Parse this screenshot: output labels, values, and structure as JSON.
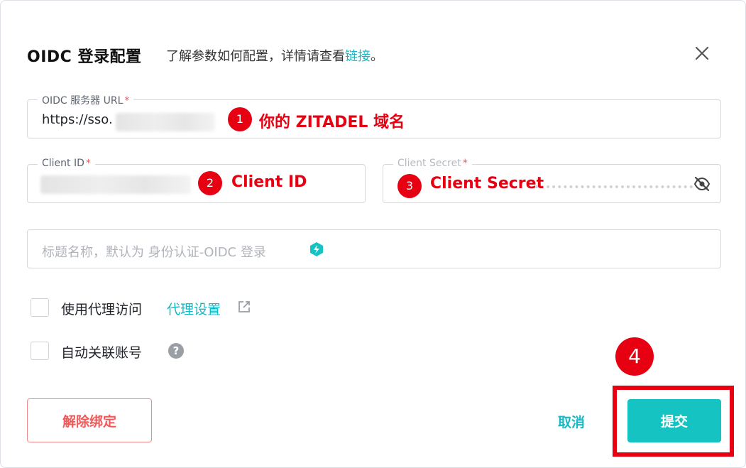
{
  "dialog": {
    "title": "OIDC 登录配置",
    "subtitle_prefix": "了解参数如何配置，详情请查看",
    "subtitle_link": "链接",
    "subtitle_suffix": "。",
    "close_icon": "close-icon"
  },
  "fields": {
    "server_url": {
      "label": "OIDC 服务器 URL",
      "required": "*",
      "value": "https://sso."
    },
    "client_id": {
      "label": "Client ID",
      "required": "*"
    },
    "client_secret": {
      "label": "Client Secret",
      "required": "*",
      "icon": "eye-off-icon"
    },
    "title": {
      "placeholder": "标题名称，默认为 身份认证-OIDC 登录",
      "icon": "brand-icon"
    }
  },
  "annotations": {
    "one": {
      "num": "1",
      "text": "你的 ZITADEL 域名"
    },
    "two": {
      "num": "2",
      "text": "Client ID"
    },
    "three": {
      "num": "3",
      "text": "Client Secret"
    },
    "four": {
      "num": "4"
    }
  },
  "options": {
    "use_proxy": {
      "label": "使用代理访问",
      "link": "代理设置",
      "checked": false
    },
    "auto_link": {
      "label": "自动关联账号",
      "help": "?",
      "checked": false
    }
  },
  "buttons": {
    "unbind": "解除绑定",
    "cancel": "取消",
    "submit": "提交"
  },
  "colors": {
    "accent": "#15c3c3",
    "link": "#15b8c4",
    "danger": "#f05a5a",
    "annotation": "#e60012"
  }
}
